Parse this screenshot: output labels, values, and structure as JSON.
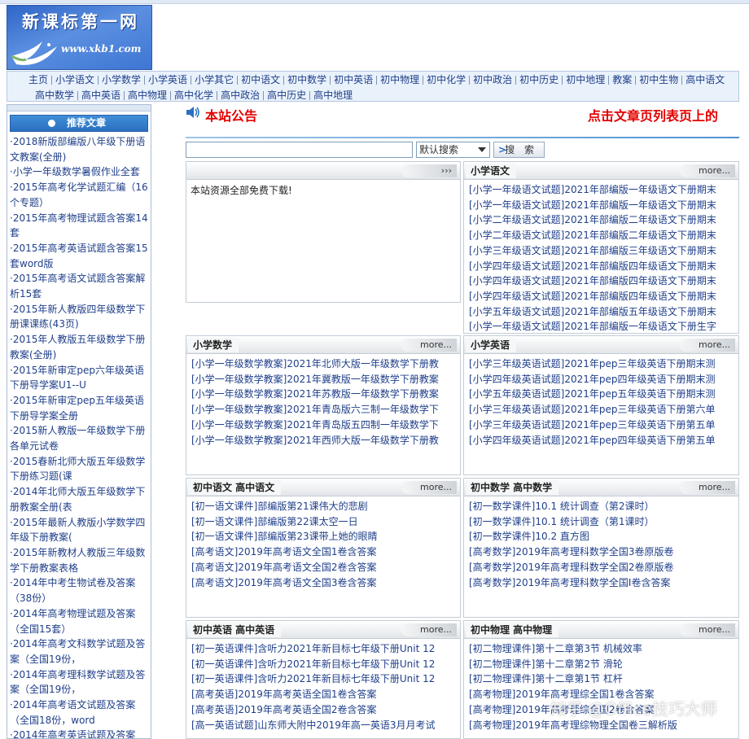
{
  "header": {
    "logo_title": "新课标第一网",
    "logo_url_text": "www.xkb1.com"
  },
  "nav": {
    "row1": [
      "主页",
      "小学语文",
      "小学数学",
      "小学英语",
      "小学其它",
      "初中语文",
      "初中数学",
      "初中英语",
      "初中物理",
      "初中化学",
      "初中政治",
      "初中历史",
      "初中地理",
      "教案",
      "初中生物",
      "高中语文"
    ],
    "row2": [
      "高中数学",
      "高中英语",
      "高中物理",
      "高中化学",
      "高中政治",
      "高中历史",
      "高中地理"
    ]
  },
  "sidebar": {
    "title": "推荐文章",
    "items": [
      "·2018新版部编版八年级下册语",
      "文教案(全册)",
      "·小学一年级数学暑假作业全套",
      "·2015年高考化学试题汇编（16",
      "个专题）",
      "·2015年高考物理试题含答案14",
      "套",
      "·2015年高考英语试题含答案15",
      "套word版",
      "·2015年高考语文试题含答案解",
      "析15套",
      "·2015年新人教版四年级数学下",
      "册课课练(43页)",
      "·2015年人教版五年级数学下册",
      "教案(全册)",
      "·2015年新审定pep六年级英语",
      "下册导学案U1--U",
      "·2015年新审定pep五年级英语",
      "下册导学案全册",
      "·2015新人教版一年级数学下册",
      "各单元试卷",
      "·2015春新北师大版五年级数学",
      "下册练习题(课",
      "·2014年北师大版五年级数学下",
      "册教案全册(表",
      "·2015年最新人教版小学数学四",
      "年级下册教案(",
      "·2015年新教材人教版三年级数",
      "学下册教案表格",
      "·2014年中考生物试卷及答案",
      "（38份）",
      "·2014年高考物理试题及答案",
      "（全国15套）",
      "·2014年高考文科数学试题及答",
      "案（全国19份，",
      "·2014年高考理科数学试题及答",
      "案（全国19份，",
      "·2014年高考语文试题及答案",
      "（全国18份，word",
      "·2014年高考英语试题及答案"
    ]
  },
  "announcement": {
    "title": "本站公告",
    "marquee": "点击文章页列表页上的"
  },
  "search": {
    "select_value": "默认搜索",
    "button_label": "搜 索",
    "button_arrow": ">"
  },
  "panels": {
    "notice": {
      "more": "›››",
      "text": "本站资源全部免费下载!"
    },
    "p_xxyw": {
      "title": "小学语文",
      "more": "more...",
      "items": [
        "[小学一年级语文试题]2021年部编版一年级语文下册期末",
        "[小学一年级语文试题]2021年部编版一年级语文下册期末",
        "[小学二年级语文试题]2021年部编版二年级语文下册期末",
        "[小学二年级语文试题]2021年部编版二年级语文下册期末",
        "[小学三年级语文试题]2021年部编版三年级语文下册期末",
        "[小学四年级语文试题]2021年部编版四年级语文下册期末",
        "[小学四年级语文试题]2021年部编版四年级语文下册期末",
        "[小学四年级语文试题]2021年部编版四年级语文下册期末",
        "[小学五年级语文试题]2021年部编版五年级语文下册期末",
        "[小学一年级语文试题]2021年部编版一年级语文下册生字"
      ]
    },
    "p_xxsx": {
      "title": "小学数学",
      "more": "more...",
      "items": [
        "[小学一年级数学教案]2021年北师大版一年级数学下册教",
        "[小学一年级数学教案]2021年冀教版一年级数学下册教案",
        "[小学一年级数学教案]2021年苏教版一年级数学下册教案",
        "[小学一年级数学教案]2021年青岛版六三制一年级数学下",
        "[小学一年级数学教案]2021年青岛版五四制一年级数学下",
        "[小学一年级数学教案]2021年西师大版一年级数学下册教"
      ]
    },
    "p_xxyy": {
      "title": "小学英语",
      "more": "more...",
      "items": [
        "[小学三年级英语试题]2021年pep三年级英语下册期末测",
        "[小学四年级英语试题]2021年pep四年级英语下册期末测",
        "[小学五年级英语试题]2021年pep五年级英语下册期末测",
        "[小学三年级英语试题]2021年pep三年级英语下册第六单",
        "[小学三年级英语试题]2021年pep三年级英语下册第五单",
        "[小学四年级英语试题]2021年pep四年级英语下册第五单"
      ]
    },
    "p_czyw": {
      "title": "初中语文  高中语文",
      "more": "more...",
      "items": [
        "[初一语文课件]部编版第21课伟大的悲剧",
        "[初一语文课件]部编版第22课太空一日",
        "[初一语文课件]部编版第23课带上她的眼睛",
        "[高考语文]2019年高考语文全国1卷含答案",
        "[高考语文]2019年高考语文全国2卷含答案",
        "[高考语文]2019年高考语文全国3卷含答案"
      ]
    },
    "p_czsx": {
      "title": "初中数学  高中数学",
      "more": "more...",
      "items": [
        "[初一数学课件]10.1 统计调查（第2课时）",
        "[初一数学课件]10.1 统计调查（第1课时）",
        "[初一数学课件]10.2 直方图",
        "[高考数学]2019年高考理科数学全国3卷原版卷",
        "[高考数学]2019年高考理科数学全国2卷原版卷",
        "[高考数学]2019年高考理科数学全国I卷含答案"
      ]
    },
    "p_czyy": {
      "title": "初中英语  高中英语",
      "more": "more...",
      "items": [
        "[初一英语课件]含听力2021年新目标七年级下册Unit 12",
        "[初一英语课件]含听力2021年新目标七年级下册Unit 12",
        "[初一英语课件]含听力2021年新目标七年级下册Unit 12",
        "[高考英语]2019年高考英语全国1卷含答案",
        "[高考英语]2019年高考英语全国2卷含答案",
        "[高一英语试题]山东师大附中2019年高一英语3月月考试"
      ]
    },
    "p_czwl": {
      "title": "初中物理    高中物理",
      "more": "more...",
      "items": [
        "[初二物理课件]第十二章第3节 机械效率",
        "[初二物理课件]第十二章第2节 滑轮",
        "[初二物理课件]第十二章第1节 杠杆",
        "[高考物理]2019年高考理综全国1卷含答案",
        "[高考物理]2019年高考理综全国2卷含答案",
        "[高考物理]2019年高考理综物理全国卷三解析版"
      ]
    }
  },
  "watermark": "知乎 @Office技巧大师"
}
